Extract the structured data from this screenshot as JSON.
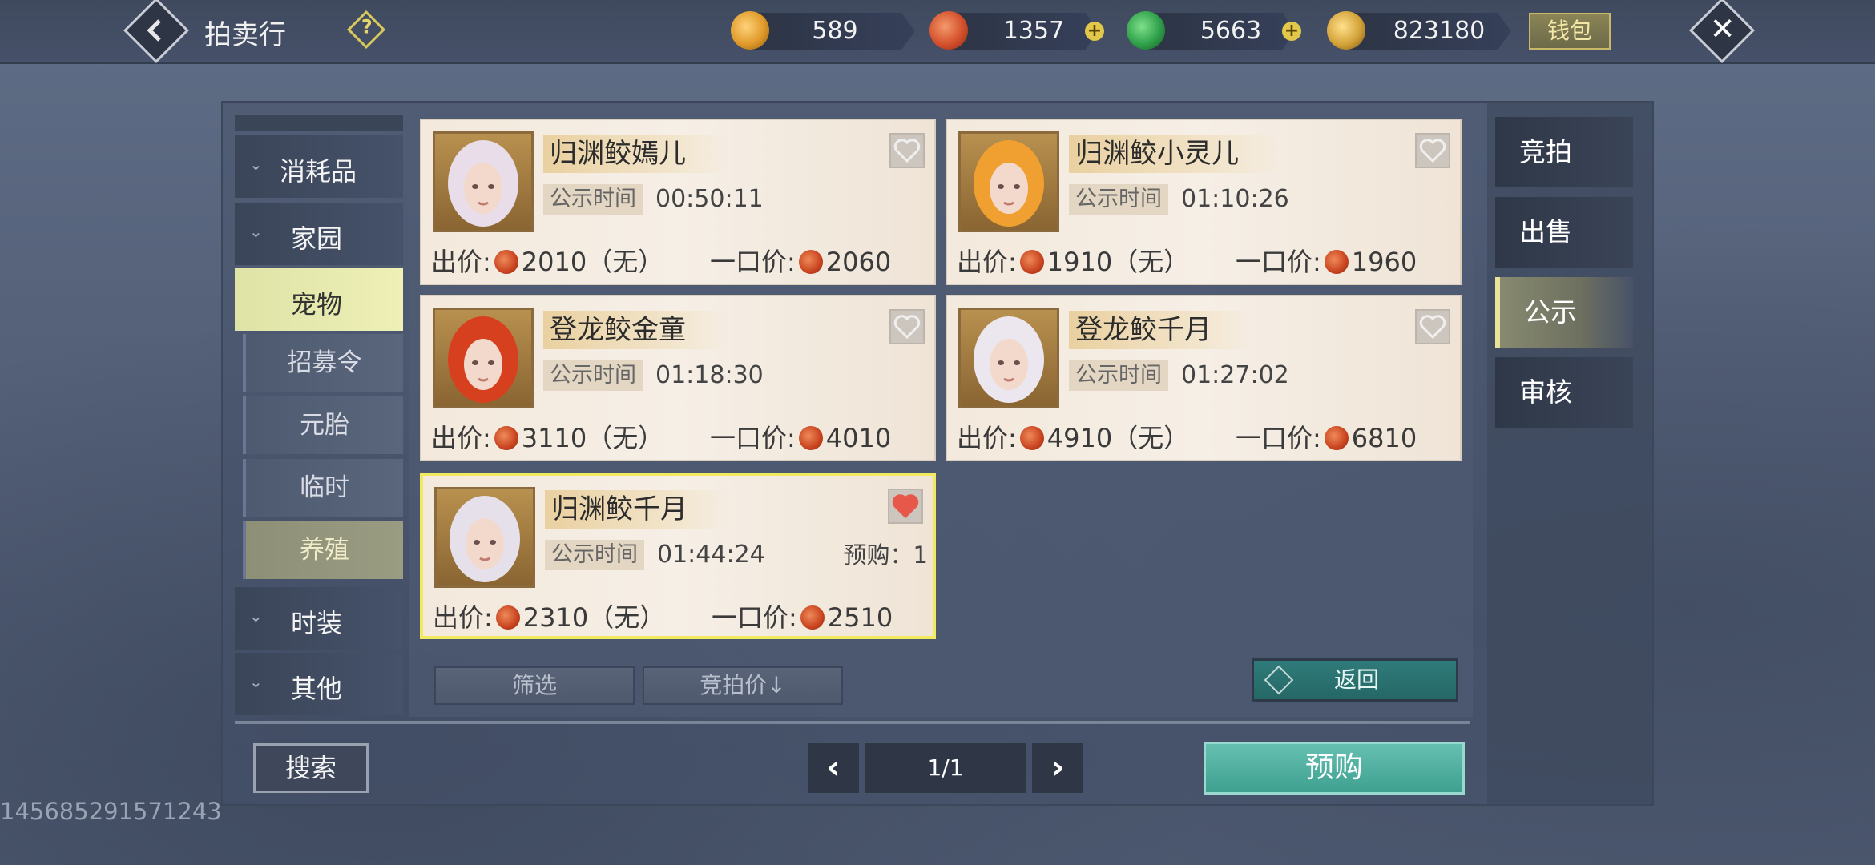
{
  "header": {
    "title": "拍卖行",
    "help_icon": "question-icon",
    "currencies": [
      {
        "name": "gold-ingot-icon",
        "value": "589",
        "color": "#e09a2a"
      },
      {
        "name": "red-coin-icon",
        "value": "1357",
        "color": "#d4502c"
      },
      {
        "name": "jade-icon",
        "value": "5663",
        "color": "#2fa04a"
      },
      {
        "name": "silver-icon",
        "value": "823180",
        "color": "#d3a23a"
      }
    ],
    "wallet_label": "钱包"
  },
  "categories": {
    "items": [
      {
        "label": "消耗品"
      },
      {
        "label": "家园"
      },
      {
        "label": "宠物"
      },
      {
        "label": "时装"
      },
      {
        "label": "其他"
      }
    ],
    "pet_subitems": [
      {
        "label": "招募令"
      },
      {
        "label": "元胎"
      },
      {
        "label": "临时"
      },
      {
        "label": "养殖"
      }
    ]
  },
  "listings": [
    {
      "name": "归渊鲛嫣儿",
      "time_label": "公示时间",
      "time": "00:50:11",
      "bid_label": "出价:",
      "bid": "2010（无）",
      "buyout_label": "一口价:",
      "buyout": "2060",
      "favorited": false,
      "hair": "#e8dde8"
    },
    {
      "name": "归渊鲛小灵儿",
      "time_label": "公示时间",
      "time": "01:10:26",
      "bid_label": "出价:",
      "bid": "1910（无）",
      "buyout_label": "一口价:",
      "buyout": "1960",
      "favorited": false,
      "hair": "#f0a030"
    },
    {
      "name": "登龙鲛金童",
      "time_label": "公示时间",
      "time": "01:18:30",
      "bid_label": "出价:",
      "bid": "3110（无）",
      "buyout_label": "一口价:",
      "buyout": "4010",
      "favorited": false,
      "hair": "#d6401e"
    },
    {
      "name": "登龙鲛千月",
      "time_label": "公示时间",
      "time": "01:27:02",
      "bid_label": "出价:",
      "bid": "4910（无）",
      "buyout_label": "一口价:",
      "buyout": "6810",
      "favorited": false,
      "hair": "#ece6ef"
    },
    {
      "name": "归渊鲛千月",
      "time_label": "公示时间",
      "time": "01:44:24",
      "prepurchase": "预购：1",
      "bid_label": "出价:",
      "bid": "2310（无）",
      "buyout_label": "一口价:",
      "buyout": "2510",
      "favorited": true,
      "hair": "#e6e0ea"
    }
  ],
  "controls": {
    "filter_label": "筛选",
    "sort_label": "竞拍价↓",
    "return_label": "返回",
    "search_label": "搜索",
    "page": "1/1",
    "prebuy_label": "预购"
  },
  "tabs": [
    {
      "label": "竞拍"
    },
    {
      "label": "出售"
    },
    {
      "label": "公示"
    },
    {
      "label": "审核"
    }
  ],
  "uid": "145685291571243",
  "colors": {
    "accent_yellow": "#f1ea5e",
    "teal_button": "#3ea090",
    "heart_active": "#e8584a"
  }
}
